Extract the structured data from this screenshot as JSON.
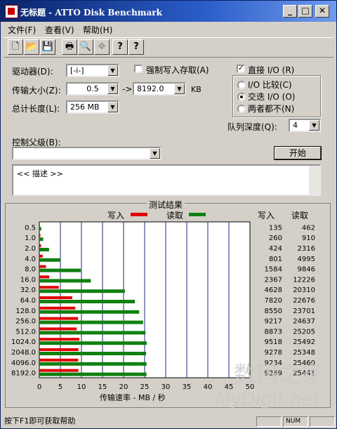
{
  "window": {
    "title": "无标题 - ATTO Disk Benchmark",
    "controls": [
      "_",
      "□",
      "✕"
    ]
  },
  "menu": [
    "文件(F)",
    "查看(V)",
    "帮助(H)"
  ],
  "toolbar": {
    "icons": [
      "new-document-icon",
      "open-folder-icon",
      "save-icon",
      "print-icon",
      "print-preview-icon",
      "move-icon",
      "help-icon",
      "context-help-icon"
    ],
    "glyphs": [
      "🗋",
      "📂",
      "💾",
      "🖶",
      "🔍",
      "✥",
      "?",
      "?"
    ]
  },
  "form": {
    "drive_label": "驱动器(D):",
    "drive_value": "[-i-]",
    "force_write_label": "强制写入存取(A)",
    "direct_io_label": "直接 I/O (R)",
    "direct_io_checked": true,
    "transfer_label": "传输大小(Z):",
    "transfer_from": "0.5",
    "transfer_to_symbol": "->",
    "transfer_to": "8192.0",
    "transfer_unit": "KB",
    "total_label": "总计长度(L):",
    "total_value": "256 MB",
    "radio_compare": "I/O 比较(C)",
    "radio_overlap": "交迭 I/O (O)",
    "radio_neither": "两者都不(N)",
    "radio_selected": "overlap",
    "queue_label": "队列深度(Q):",
    "queue_value": "4",
    "control_label": "控制父级(B):",
    "control_value": "",
    "start_button": "开始",
    "description": "<< 描述 >>"
  },
  "results": {
    "group_title": "测试结果",
    "legend_write": "写入",
    "legend_read": "读取",
    "col_write": "写入",
    "col_read": "读取",
    "write_color": "#e00000",
    "read_color": "#108010",
    "xlabel": "传输速率 - MB / 秒"
  },
  "chart_data": {
    "type": "bar",
    "orientation": "horizontal",
    "categories": [
      "0.5",
      "1.0",
      "2.0",
      "4.0",
      "8.0",
      "16.0",
      "32.0",
      "64.0",
      "128.0",
      "256.0",
      "512.0",
      "1024.0",
      "2048.0",
      "4096.0",
      "8192.0"
    ],
    "series": [
      {
        "name": "写入",
        "values": [
          135,
          260,
          424,
          801,
          1584,
          2367,
          4628,
          7820,
          8550,
          9217,
          8873,
          9518,
          9278,
          9234,
          9269
        ]
      },
      {
        "name": "读取",
        "values": [
          462,
          910,
          2316,
          4995,
          9846,
          12226,
          20310,
          22676,
          23701,
          24637,
          25205,
          25492,
          25348,
          25460,
          25441
        ]
      }
    ],
    "table_write": [
      "135",
      "260",
      "424",
      "801",
      "1584",
      "2367",
      "4628",
      "7820",
      "8550",
      "9217",
      "8873",
      "9518",
      "9278",
      "9234",
      "9269"
    ],
    "table_read": [
      "462",
      "910",
      "2316",
      "4995",
      "9846",
      "12226",
      "20310",
      "22676",
      "23701",
      "24637",
      "25205",
      "25492",
      "25348",
      "25460",
      "25441"
    ],
    "xticks": [
      "0",
      "5",
      "10",
      "15",
      "20",
      "25",
      "30",
      "35",
      "40",
      "45",
      "50"
    ],
    "xlim": [
      0,
      50
    ],
    "xlabel": "传输速率 - MB / 秒",
    "grid": true
  },
  "watermark": {
    "line1": "数码之家",
    "line2": "MyDigit.net"
  },
  "status": {
    "help": "按下F1即可获取帮助",
    "num": "NUM"
  }
}
